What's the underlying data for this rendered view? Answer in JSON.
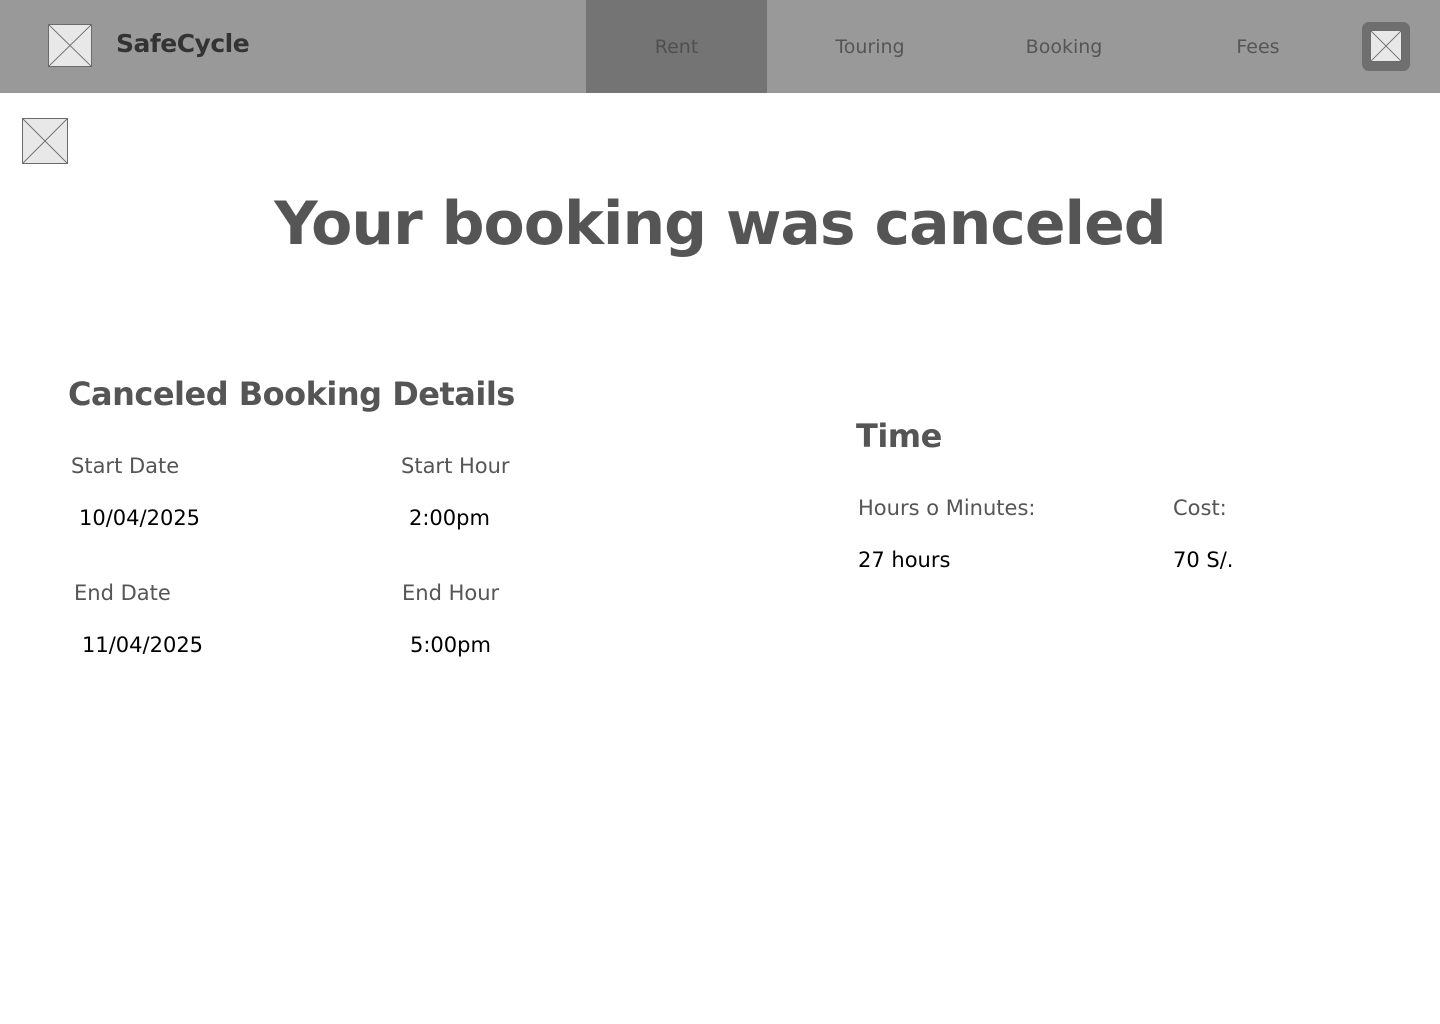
{
  "navbar": {
    "brand": "SafeCycle",
    "logo_icon": "image-placeholder-icon",
    "items": [
      {
        "label": "Rent",
        "active": true
      },
      {
        "label": "Touring",
        "active": false
      },
      {
        "label": "Booking",
        "active": false
      },
      {
        "label": "Fees",
        "active": false
      }
    ],
    "profile_icon": "image-placeholder-icon"
  },
  "back_icon": "image-placeholder-icon",
  "page": {
    "title": "Your booking was canceled"
  },
  "details": {
    "title": "Canceled Booking Details",
    "start_date_label": "Start Date",
    "start_date": "10/04/2025",
    "start_hour_label": "Start Hour",
    "start_hour": "2:00pm",
    "end_date_label": "End Date",
    "end_date": "11/04/2025",
    "end_hour_label": "End Hour",
    "end_hour": "5:00pm"
  },
  "time": {
    "title": "Time",
    "duration_label": "Hours o Minutes:",
    "duration": "27 hours",
    "cost_label": "Cost:",
    "cost": "70 S/."
  },
  "colors": {
    "navbar_bg": "#999999",
    "nav_active_bg": "#747474",
    "heading_text": "#555555",
    "value_text": "#000000"
  }
}
